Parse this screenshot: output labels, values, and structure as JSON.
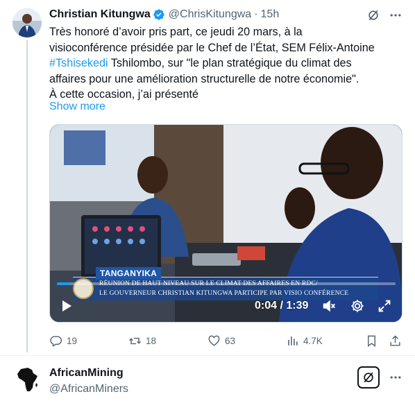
{
  "tweet": {
    "author_name": "Christian Kitungwa",
    "author_handle": "@ChrisKitungwa",
    "separator": "·",
    "time": "15h",
    "text_lines": [
      "Très honoré d’avoir pris part, ce jeudi 20 mars, à la",
      "visioconférence présidée par le Chef de l’État, SEM Félix-Antoine",
      "",
      "affaires pour une amélioration structurelle de notre économie\".",
      "À cette occasion, j’ai présenté"
    ],
    "hashtag": "#Tshisekedi",
    "line3_rest": " Tshilombo, sur \"le plan stratégique du climat des",
    "show_more": "Show more",
    "video": {
      "region_label": "TANGANYIKA",
      "ticker_line1": "RÉUNION DE HAUT NIVEAU SUR LE CLIMAT DES AFFAIRES EN RDC/",
      "ticker_line2": "LE GOUVERNEUR CHRISTIAN KITUNGWA PARTICIPE PAR VISIO CONFÉRENCE",
      "timecode": "0:04 / 1:39",
      "progress_fraction": 0.04
    },
    "actions": {
      "replies": "19",
      "reposts": "18",
      "likes": "63",
      "views": "4.7K"
    }
  },
  "next_tweet": {
    "author_name": "AfricanMining",
    "author_handle": "@AfricanMiners"
  },
  "colors": {
    "accent": "#1d9bf0",
    "secondary_text": "#536471",
    "primary_text": "#0f1419"
  }
}
